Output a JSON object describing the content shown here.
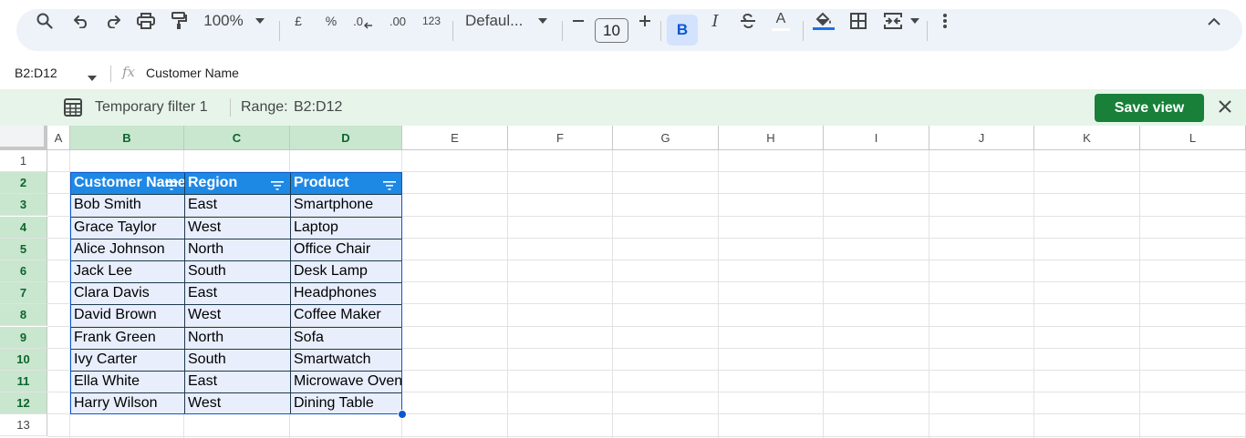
{
  "toolbar": {
    "zoom": "100%",
    "currency": "£",
    "percent": "%",
    "decrease_decimal": ".0",
    "increase_decimal": ".00",
    "number_format": "123",
    "font": "Defaul...",
    "font_size": "10",
    "bold": "B",
    "italic": "I",
    "text_color": "A",
    "fill_color_accent": "#1a73e8"
  },
  "formula_bar": {
    "name_box": "B2:D12",
    "fx": "fx",
    "content": "Customer Name"
  },
  "filter_bar": {
    "name": "Temporary filter 1",
    "range_label": "Range:",
    "range_value": "B2:D12",
    "save_view": "Save view"
  },
  "columns": [
    "A",
    "B",
    "C",
    "D",
    "E",
    "F",
    "G",
    "H",
    "I",
    "J",
    "K",
    "L"
  ],
  "rows": [
    "1",
    "2",
    "3",
    "4",
    "5",
    "6",
    "7",
    "8",
    "9",
    "10",
    "11",
    "12",
    "13"
  ],
  "table": {
    "headers": [
      "Customer Name",
      "Region",
      "Product"
    ],
    "rows": [
      [
        "Bob Smith",
        "East",
        "Smartphone"
      ],
      [
        "Grace Taylor",
        "West",
        "Laptop"
      ],
      [
        "Alice Johnson",
        "North",
        "Office Chair"
      ],
      [
        "Jack Lee",
        "South",
        "Desk Lamp"
      ],
      [
        "Clara Davis",
        "East",
        "Headphones"
      ],
      [
        "David Brown",
        "West",
        "Coffee Maker"
      ],
      [
        "Frank Green",
        "North",
        "Sofa"
      ],
      [
        "Ivy Carter",
        "South",
        "Smartwatch"
      ],
      [
        "Ella White",
        "East",
        "Microwave Oven"
      ],
      [
        "Harry Wilson",
        "West",
        "Dining Table"
      ]
    ]
  },
  "colors": {
    "header_fill": "#1e88e5",
    "body_fill": "#e8eefc",
    "selection": "#0b57d0",
    "filter_bar": "#e6f4ea",
    "save_button": "#188038"
  }
}
